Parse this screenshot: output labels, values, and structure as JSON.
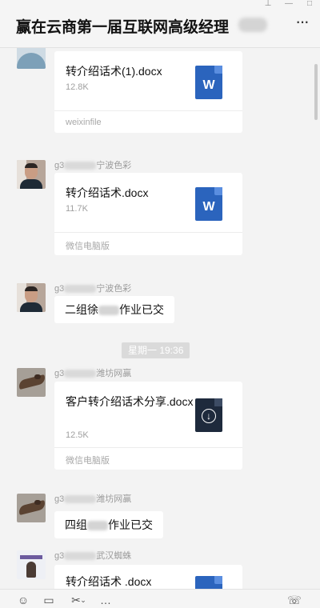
{
  "header": {
    "title": "赢在云商第一届互联网高级经理",
    "window_controls": [
      "pin-icon",
      "minimize-icon",
      "maximize-icon"
    ],
    "more_label": "···"
  },
  "messages": [
    {
      "kind": "file",
      "file_name": "转介绍话术(1).docx",
      "file_size": "12.8K",
      "source": "weixinfile",
      "file_icon": "word-icon"
    },
    {
      "kind": "file",
      "sender_prefix": "g3",
      "sender_suffix": "宁波色彩",
      "file_name": "转介绍话术.docx",
      "file_size": "11.7K",
      "source": "微信电脑版",
      "file_icon": "word-icon"
    },
    {
      "kind": "text",
      "sender_prefix": "g3",
      "sender_suffix": "宁波色彩",
      "text_before": "二组徐",
      "text_after": "作业已交"
    },
    {
      "kind": "time",
      "text": "星期一 19:36"
    },
    {
      "kind": "file",
      "sender_prefix": "g3",
      "sender_suffix": "潍坊网赢",
      "file_name": "客户转介绍话术分享.docx",
      "file_size": "12.5K",
      "source": "微信电脑版",
      "file_icon": "download-icon"
    },
    {
      "kind": "text",
      "sender_prefix": "g3",
      "sender_suffix": "潍坊网赢",
      "text_before": "四组",
      "text_after": "作业已交"
    },
    {
      "kind": "file",
      "sender_prefix": "g3",
      "sender_suffix": "武汉蜘蛛",
      "file_name": "转介绍话术 .docx",
      "file_icon": "word-icon"
    }
  ],
  "toolbar": {
    "left_tools": [
      "emoji-icon",
      "folder-icon",
      "scissors-icon",
      "chat-history-icon"
    ],
    "right_tool": "video-call-icon"
  },
  "colors": {
    "chat_background": "#f3f3f3",
    "bubble_background": "#ffffff",
    "word_icon": "#2b64bd",
    "download_icon": "#1e2a3c",
    "time_chip": "#dadada"
  }
}
